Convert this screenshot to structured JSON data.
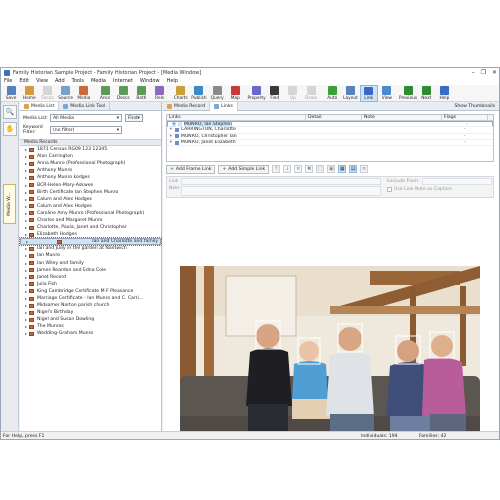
{
  "window": {
    "title": "Family Historian Sample Project - Family Historian Project - [Media Window]",
    "controls": [
      "–",
      "❐",
      "✕"
    ]
  },
  "menu": [
    "File",
    "Edit",
    "View",
    "Add",
    "Tools",
    "Media",
    "Internet",
    "Window",
    "Help"
  ],
  "toolbar": [
    {
      "label": "Save",
      "icon": "save-icon",
      "color": "#5a7fc0"
    },
    {
      "label": "Home",
      "icon": "home-icon",
      "color": "#d49a3b"
    },
    {
      "label": "Focus",
      "icon": "focus-icon",
      "color": "#999999",
      "disabled": true
    },
    {
      "label": "Source",
      "icon": "source-icon",
      "color": "#7aa0c8"
    },
    {
      "label": "Media",
      "icon": "media-icon",
      "color": "#c86a3a"
    },
    {
      "label": "Ancs",
      "icon": "ancestors-icon",
      "color": "#5b9a5b",
      "sep": true
    },
    {
      "label": "Descs",
      "icon": "descendants-icon",
      "color": "#5b9a5b"
    },
    {
      "label": "Both",
      "icon": "both-icon",
      "color": "#5b9a5b"
    },
    {
      "label": "Rels",
      "icon": "relatives-icon",
      "color": "#8a6ac0"
    },
    {
      "label": "Charts",
      "icon": "charts-icon",
      "color": "#c8a03a",
      "sep": true
    },
    {
      "label": "Publish",
      "icon": "publish-icon",
      "color": "#3a8ac8"
    },
    {
      "label": "Query",
      "icon": "query-icon",
      "color": "#8a8a8a"
    },
    {
      "label": "Map",
      "icon": "map-icon",
      "color": "#c83a3a"
    },
    {
      "label": "Property",
      "icon": "property-icon",
      "color": "#6a6ac8",
      "sep": true
    },
    {
      "label": "Find",
      "icon": "find-icon",
      "color": "#3a3a3a"
    },
    {
      "label": "Up",
      "icon": "up-icon",
      "color": "#999999",
      "disabled": true
    },
    {
      "label": "Down",
      "icon": "down-icon",
      "color": "#999999",
      "disabled": true
    },
    {
      "label": "Auto",
      "icon": "auto-icon",
      "color": "#3aa03a",
      "sep": true
    },
    {
      "label": "Layout",
      "icon": "layout-icon",
      "color": "#5a7fc0"
    },
    {
      "label": "Link",
      "icon": "link-icon",
      "color": "#3a6ac8",
      "active": true
    },
    {
      "label": "View",
      "icon": "view-icon",
      "color": "#4a8ad0"
    },
    {
      "label": "Previous",
      "icon": "previous-icon",
      "color": "#2e8b2e",
      "sep": true
    },
    {
      "label": "Next",
      "icon": "next-icon",
      "color": "#2e8b2e"
    },
    {
      "label": "Help",
      "icon": "help-icon",
      "color": "#3a6ac8"
    }
  ],
  "left_panel": {
    "tabs": [
      "Media List",
      "Media Link Tool"
    ],
    "media_list_label": "Media List:",
    "media_list_value": "All Media",
    "find_label": "Find",
    "keyword_label": "Keyword Filter:",
    "keyword_value": "(no filter)",
    "records_header": "Media Records",
    "records": [
      "1871 Census RG09 123 12345",
      "Alan Carrington",
      "Anna Munro (Professional Photograph)",
      "Anthony Munro",
      "Anthony Munro kodges",
      "BCR-Helen-Mary-Askwen",
      "Birth Certificate Ian Stephen Munro",
      "Calum and Alex Hodges",
      "Calum and Alex Hodges",
      "Caroline Amy Munro (Professional Photograph)",
      "Charles and Margaret Munro",
      "Charlotte, Paula, Janet and Christopher",
      "Elizabeth Hodges",
      "Ian and Charlotte and family",
      "Ian and Judy in the garden at Nantwich",
      "Ian Munro",
      "Ian Wiley and family",
      "James Reardon and Edna Cole",
      "Janet Record",
      "Julia Fish",
      "King Cambridge Certificate M F Pleasance",
      "Marriage Certificate - Ian Munro and C. Carri...",
      "Midsomer Norton parish church",
      "Nigel's Birthday",
      "Nigel and Susan Dowling",
      "The Munros",
      "Wedding-Graham Munro"
    ],
    "selected_index": 13
  },
  "right_panel": {
    "tabs": [
      "Media Record",
      "Links"
    ],
    "show_thumbnails": "Show Thumbnails",
    "links_columns": [
      "Links",
      "Detail",
      "Note",
      "Flags"
    ],
    "links_rows": [
      {
        "name": "MUNRO, Ian Stephen",
        "flag": "-"
      },
      {
        "name": "CARRINGTON, Charlotte",
        "flag": "-"
      },
      {
        "name": "MUNRO, Christopher Ian",
        "flag": "-"
      },
      {
        "name": "MUNRO, Janet Elizabeth",
        "flag": "-"
      }
    ],
    "add_frame_link": "Add Frame Link",
    "add_simple_link": "Add Simple Link",
    "link_props": {
      "link_label": "Link",
      "note_label": "Note",
      "exclude_label": "Exclude From:",
      "caption_label": "Use Link Note as Caption"
    }
  },
  "status": {
    "help": "For Help, press F1",
    "individuals": "Individuals: 194",
    "families": "Families: 42"
  }
}
